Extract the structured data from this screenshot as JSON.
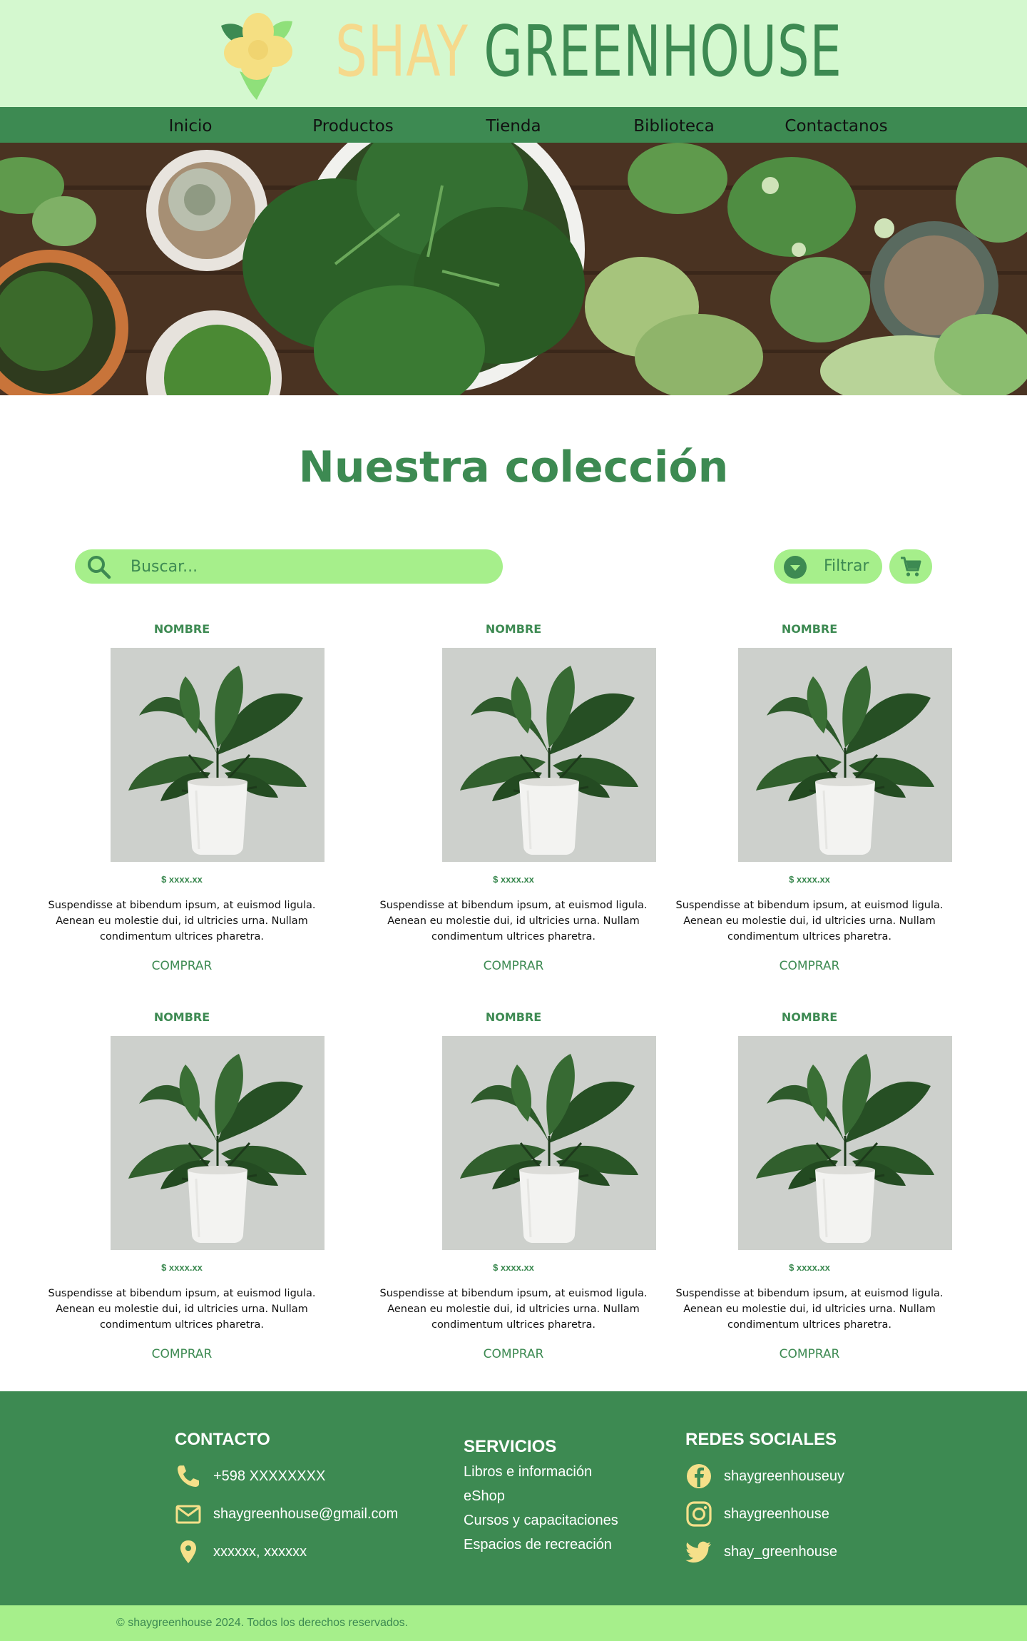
{
  "brand": {
    "part1": "SHAY",
    "part2": "GREENHOUSE"
  },
  "nav": {
    "items": [
      {
        "label": "Inicio"
      },
      {
        "label": "Productos"
      },
      {
        "label": "Tienda"
      },
      {
        "label": "Biblioteca"
      },
      {
        "label": "Contactanos"
      }
    ]
  },
  "main": {
    "title": "Nuestra colección",
    "search_placeholder": "Buscar...",
    "filter_label": "Filtrar"
  },
  "products": [
    {
      "name": "NOMBRE",
      "price": "$ xxxx.xx",
      "description": "Suspendisse at bibendum ipsum, at euismod ligula. Aenean eu molestie dui, id ultricies urna. Nullam condimentum ultrices pharetra.",
      "buy_label": "COMPRAR"
    },
    {
      "name": "NOMBRE",
      "price": "$ xxxx.xx",
      "description": "Suspendisse at bibendum ipsum, at euismod ligula. Aenean eu molestie dui, id ultricies urna. Nullam condimentum ultrices pharetra.",
      "buy_label": "COMPRAR"
    },
    {
      "name": "NOMBRE",
      "price": "$ xxxx.xx",
      "description": "Suspendisse at bibendum ipsum, at euismod ligula. Aenean eu molestie dui, id ultricies urna. Nullam condimentum ultrices pharetra.",
      "buy_label": "COMPRAR"
    },
    {
      "name": "NOMBRE",
      "price": "$ xxxx.xx",
      "description": "Suspendisse at bibendum ipsum, at euismod ligula. Aenean eu molestie dui, id ultricies urna. Nullam condimentum ultrices pharetra.",
      "buy_label": "COMPRAR"
    },
    {
      "name": "NOMBRE",
      "price": "$ xxxx.xx",
      "description": "Suspendisse at bibendum ipsum, at euismod ligula. Aenean eu molestie dui, id ultricies urna. Nullam condimentum ultrices pharetra.",
      "buy_label": "COMPRAR"
    },
    {
      "name": "NOMBRE",
      "price": "$ xxxx.xx",
      "description": "Suspendisse at bibendum ipsum, at euismod ligula. Aenean eu molestie dui, id ultricies urna. Nullam condimentum ultrices pharetra.",
      "buy_label": "COMPRAR"
    }
  ],
  "footer": {
    "contact": {
      "heading": "CONTACTO",
      "phone": "+598 XXXXXXXX",
      "email": "shaygreenhouse@gmail.com",
      "address": "xxxxxx, xxxxxx"
    },
    "services": {
      "heading": "SERVICIOS",
      "items": [
        "Libros e información",
        "eShop",
        "Cursos y capacitaciones",
        "Espacios de recreación"
      ]
    },
    "social": {
      "heading": "REDES SOCIALES",
      "facebook": "shaygreenhouseuy",
      "instagram": "shaygreenhouse",
      "twitter": "shay_greenhouse"
    },
    "copyright": "© shaygreenhouse 2024. Todos los derechos reservados."
  },
  "icons": {
    "logo": "flower-logo-icon",
    "search": "search-icon",
    "filter": "chevron-down-circle-icon",
    "cart": "cart-icon",
    "phone": "phone-icon",
    "email": "mail-icon",
    "location": "location-pin-icon",
    "facebook": "facebook-icon",
    "instagram": "instagram-icon",
    "twitter": "twitter-icon"
  },
  "colors": {
    "header_bg": "#d4f8cf",
    "primary_green": "#3d8a52",
    "light_green": "#a6ef8b",
    "accent_yellow": "#f5d98c",
    "card_image_bg": "#cdd0cc"
  }
}
